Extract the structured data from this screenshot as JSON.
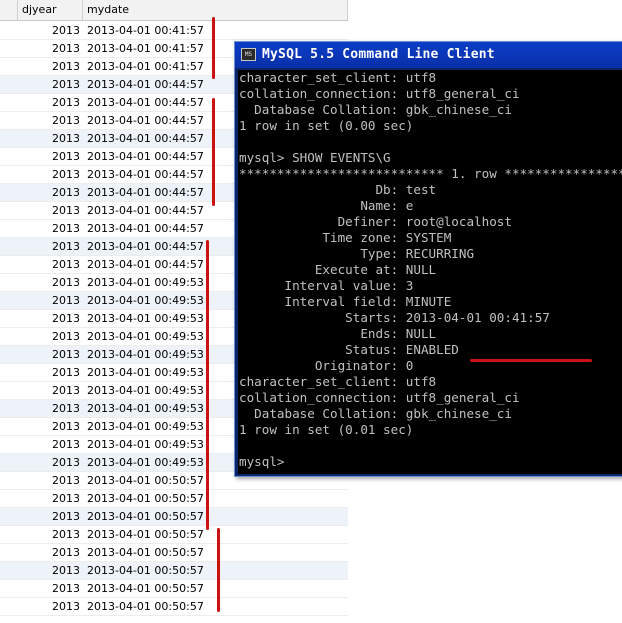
{
  "grid": {
    "headers": [
      "",
      "djyear",
      "mydate"
    ],
    "rows": [
      {
        "year": "2013",
        "date": "2013-04-01 00:41:57",
        "alt": false
      },
      {
        "year": "2013",
        "date": "2013-04-01 00:41:57",
        "alt": false
      },
      {
        "year": "2013",
        "date": "2013-04-01 00:41:57",
        "alt": false
      },
      {
        "year": "2013",
        "date": "2013-04-01 00:44:57",
        "alt": true
      },
      {
        "year": "2013",
        "date": "2013-04-01 00:44:57",
        "alt": false
      },
      {
        "year": "2013",
        "date": "2013-04-01 00:44:57",
        "alt": false
      },
      {
        "year": "2013",
        "date": "2013-04-01 00:44:57",
        "alt": true
      },
      {
        "year": "2013",
        "date": "2013-04-01 00:44:57",
        "alt": false
      },
      {
        "year": "2013",
        "date": "2013-04-01 00:44:57",
        "alt": false
      },
      {
        "year": "2013",
        "date": "2013-04-01 00:44:57",
        "alt": true
      },
      {
        "year": "2013",
        "date": "2013-04-01 00:44:57",
        "alt": false
      },
      {
        "year": "2013",
        "date": "2013-04-01 00:44:57",
        "alt": false
      },
      {
        "year": "2013",
        "date": "2013-04-01 00:44:57",
        "alt": true
      },
      {
        "year": "2013",
        "date": "2013-04-01 00:44:57",
        "alt": false
      },
      {
        "year": "2013",
        "date": "2013-04-01 00:49:53",
        "alt": false
      },
      {
        "year": "2013",
        "date": "2013-04-01 00:49:53",
        "alt": true
      },
      {
        "year": "2013",
        "date": "2013-04-01 00:49:53",
        "alt": false
      },
      {
        "year": "2013",
        "date": "2013-04-01 00:49:53",
        "alt": false
      },
      {
        "year": "2013",
        "date": "2013-04-01 00:49:53",
        "alt": true
      },
      {
        "year": "2013",
        "date": "2013-04-01 00:49:53",
        "alt": false
      },
      {
        "year": "2013",
        "date": "2013-04-01 00:49:53",
        "alt": false
      },
      {
        "year": "2013",
        "date": "2013-04-01 00:49:53",
        "alt": true
      },
      {
        "year": "2013",
        "date": "2013-04-01 00:49:53",
        "alt": false
      },
      {
        "year": "2013",
        "date": "2013-04-01 00:49:53",
        "alt": false
      },
      {
        "year": "2013",
        "date": "2013-04-01 00:49:53",
        "alt": true
      },
      {
        "year": "2013",
        "date": "2013-04-01 00:50:57",
        "alt": false
      },
      {
        "year": "2013",
        "date": "2013-04-01 00:50:57",
        "alt": false
      },
      {
        "year": "2013",
        "date": "2013-04-01 00:50:57",
        "alt": true
      },
      {
        "year": "2013",
        "date": "2013-04-01 00:50:57",
        "alt": false
      },
      {
        "year": "2013",
        "date": "2013-04-01 00:50:57",
        "alt": false
      },
      {
        "year": "2013",
        "date": "2013-04-01 00:50:57",
        "alt": true
      },
      {
        "year": "2013",
        "date": "2013-04-01 00:50:57",
        "alt": false
      },
      {
        "year": "2013",
        "date": "2013-04-01 00:50:57",
        "alt": false
      }
    ]
  },
  "annotations": {
    "mark_color": "#cc1111"
  },
  "console": {
    "icon_label": "MS",
    "title": "MySQL 5.5 Command Line Client",
    "lines": [
      "character_set_client: utf8",
      "collation_connection: utf8_general_ci",
      "  Database Collation: gbk_chinese_ci",
      "1 row in set (0.00 sec)",
      "",
      "mysql> SHOW EVENTS\\G",
      "*************************** 1. row ***************************",
      "                  Db: test",
      "                Name: e",
      "             Definer: root@localhost",
      "           Time zone: SYSTEM",
      "                Type: RECURRING",
      "          Execute at: NULL",
      "      Interval value: 3",
      "      Interval field: MINUTE",
      "              Starts: 2013-04-01 00:41:57",
      "                Ends: NULL",
      "              Status: ENABLED",
      "          Originator: 0",
      "character_set_client: utf8",
      "collation_connection: utf8_general_ci",
      "  Database Collation: gbk_chinese_ci",
      "1 row in set (0.01 sec)",
      "",
      "mysql>"
    ]
  }
}
